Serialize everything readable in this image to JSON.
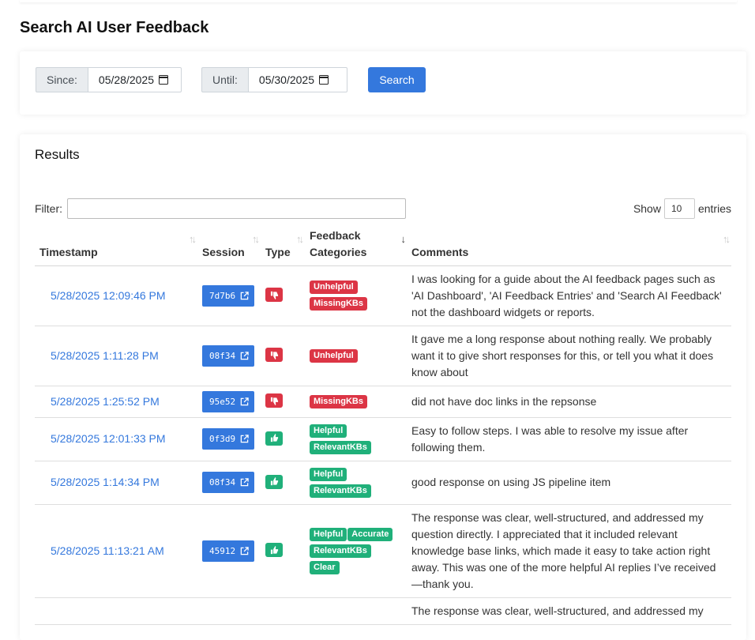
{
  "page": {
    "title": "Search AI User Feedback"
  },
  "search": {
    "since_label": "Since:",
    "since_value": "05/28/2025",
    "until_label": "Until:",
    "until_value": "05/30/2025",
    "button_label": "Search"
  },
  "results": {
    "title": "Results",
    "filter_label": "Filter:",
    "filter_value": "",
    "show_label": "Show",
    "show_value": "10",
    "entries_label": "entries",
    "columns": [
      "Timestamp",
      "Session",
      "Type",
      "Feedback Categories",
      "Comments"
    ],
    "rows": [
      {
        "timestamp": "5/28/2025 12:09:46 PM",
        "session": "7d7b6",
        "type": "thumbs-down",
        "categories": [
          "Unhelpful",
          "MissingKBs"
        ],
        "comment": "I was looking for a guide about the AI feedback pages such as 'AI Dashboard', 'AI Feedback Entries' and 'Search AI Feedback' not the dashboard widgets or reports."
      },
      {
        "timestamp": "5/28/2025 1:11:28 PM",
        "session": "08f34",
        "type": "thumbs-down",
        "categories": [
          "Unhelpful"
        ],
        "comment": "It gave me a long response about nothing really. We probably want it to give short responses for this, or tell you what it does know about"
      },
      {
        "timestamp": "5/28/2025 1:25:52 PM",
        "session": "95e52",
        "type": "thumbs-down",
        "categories": [
          "MissingKBs"
        ],
        "comment": "did not have doc links in the repsonse"
      },
      {
        "timestamp": "5/28/2025 12:01:33 PM",
        "session": "0f3d9",
        "type": "thumbs-up",
        "categories": [
          "Helpful",
          "RelevantKBs"
        ],
        "comment": "Easy to follow steps. I was able to resolve my issue after following them."
      },
      {
        "timestamp": "5/28/2025 1:14:34 PM",
        "session": "08f34",
        "type": "thumbs-up",
        "categories": [
          "Helpful",
          "RelevantKBs"
        ],
        "comment": "good response on using JS pipeline item"
      },
      {
        "timestamp": "5/28/2025 11:13:21 AM",
        "session": "45912",
        "type": "thumbs-up",
        "categories": [
          "Helpful",
          "Accurate",
          "RelevantKBs",
          "Clear"
        ],
        "comment": "The response was clear, well-structured, and addressed my question directly. I appreciated that it included relevant knowledge base links, which made it easy to take action right away. This was one of the more helpful AI replies I’ve received—thank you."
      },
      {
        "timestamp": "",
        "session": "",
        "type": "",
        "categories": [],
        "comment": "The response was clear, well-structured, and addressed my"
      }
    ]
  },
  "colors": {
    "primary": "#3478dd",
    "danger": "#dc3545",
    "success": "#20b07a"
  }
}
